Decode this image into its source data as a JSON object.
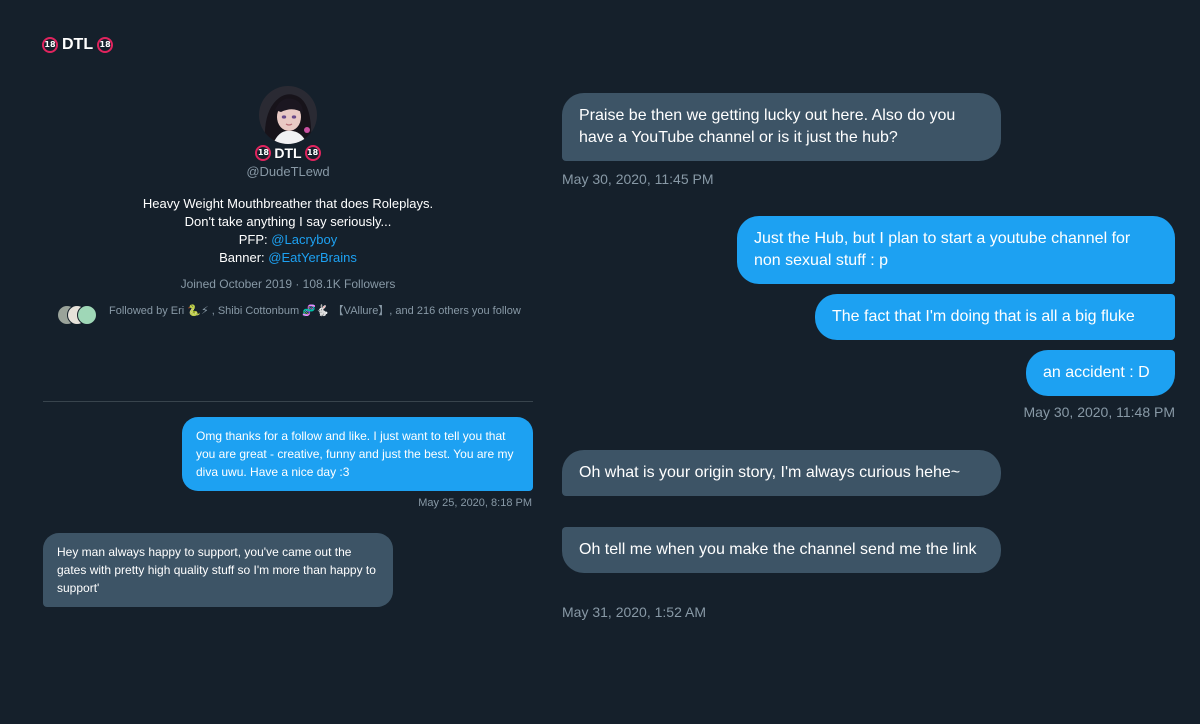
{
  "header": {
    "name": "DTL",
    "badge": "18"
  },
  "profile": {
    "name": "DTL",
    "badge": "18",
    "handle": "@DudeTLewd",
    "bio_line1": "Heavy Weight Mouthbreather that does Roleplays.",
    "bio_line2": "Don't take anything I say seriously...",
    "pfp_label": "PFP: ",
    "pfp_link": "@Lacryboy",
    "banner_label": "Banner: ",
    "banner_link": "@EatYerBrains",
    "joined": "Joined October 2019 · 108.1K Followers",
    "followed_by": "Followed by Eri 🐍⚡ , Shibi Cottonbum 🧬🐇 【VAllure】, and 216 others you follow"
  },
  "left_conversation": {
    "messages": [
      {
        "text": "Omg thanks for a follow and like. I just want to tell you that you are great - creative, funny and just the best. You are my diva uwu. Have a nice day :3",
        "timestamp": "May 25, 2020, 8:18 PM"
      },
      {
        "text": "Hey man always happy to support, you've came out the gates with pretty high quality stuff so I'm more than happy to support'"
      }
    ]
  },
  "right_conversation": {
    "messages": [
      {
        "text": "Praise be then we getting lucky out here. Also do you have a YouTube channel or is it just the hub?",
        "timestamp": "May 30, 2020, 11:45 PM"
      },
      {
        "text": "Just the Hub, but I plan to start a youtube channel for non sexual stuff : p"
      },
      {
        "text": "The fact that I'm doing that is all a big fluke"
      },
      {
        "text": "an accident : D",
        "timestamp": "May 30, 2020, 11:48 PM"
      },
      {
        "text": "Oh what is your origin story, I'm always curious hehe~"
      },
      {
        "text": "Oh tell me when you make the channel send me the link",
        "timestamp": "May 31, 2020, 1:52 AM"
      }
    ]
  },
  "colors": {
    "background": "#15202b",
    "sent_bubble": "#1da1f2",
    "received_bubble": "#3d5466",
    "muted_text": "#8899a6",
    "link": "#1da1f2",
    "badge_ring": "#e0245e"
  }
}
